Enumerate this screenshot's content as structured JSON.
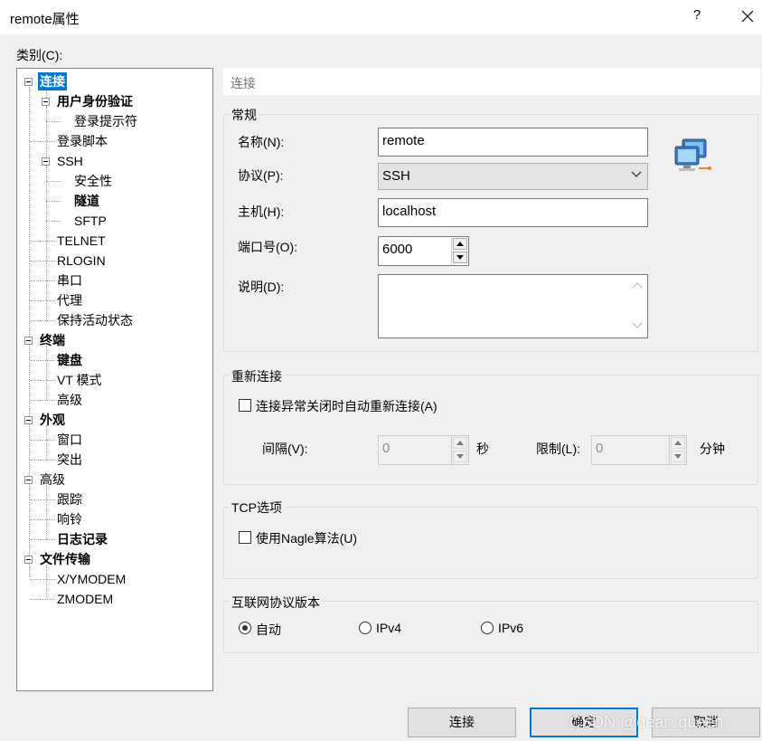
{
  "window": {
    "title": "remote属性",
    "help": "?"
  },
  "category_label": "类别(C):",
  "tree": {
    "items": [
      {
        "label": "连接"
      },
      {
        "label": "用户身份验证"
      },
      {
        "label": "登录提示符"
      },
      {
        "label": "登录脚本"
      },
      {
        "label": "SSH"
      },
      {
        "label": "安全性"
      },
      {
        "label": "隧道"
      },
      {
        "label": "SFTP"
      },
      {
        "label": "TELNET"
      },
      {
        "label": "RLOGIN"
      },
      {
        "label": "串口"
      },
      {
        "label": "代理"
      },
      {
        "label": "保持活动状态"
      },
      {
        "label": "终端"
      },
      {
        "label": "键盘"
      },
      {
        "label": "VT 模式"
      },
      {
        "label": "高级"
      },
      {
        "label": "外观"
      },
      {
        "label": "窗口"
      },
      {
        "label": "突出"
      },
      {
        "label": "高级"
      },
      {
        "label": "跟踪"
      },
      {
        "label": "响铃"
      },
      {
        "label": "日志记录"
      },
      {
        "label": "文件传输"
      },
      {
        "label": "X/YMODEM"
      },
      {
        "label": "ZMODEM"
      }
    ]
  },
  "panel": {
    "header": "连接",
    "general": {
      "title": "常规",
      "name_label": "名称(N):",
      "name_value": "remote",
      "protocol_label": "协议(P):",
      "protocol_value": "SSH",
      "host_label": "主机(H):",
      "host_value": "localhost",
      "port_label": "端口号(O):",
      "port_value": "6000",
      "desc_label": "说明(D):",
      "desc_value": ""
    },
    "reconnect": {
      "title": "重新连接",
      "auto_label": "连接异常关闭时自动重新连接(A)",
      "interval_label": "间隔(V):",
      "interval_value": "0",
      "interval_unit": "秒",
      "limit_label": "限制(L):",
      "limit_value": "0",
      "limit_unit": "分钟"
    },
    "tcp": {
      "title": "TCP选项",
      "nagle_label": "使用Nagle算法(U)"
    },
    "ipver": {
      "title": "互联网协议版本",
      "options": [
        "自动",
        "IPv4",
        "IPv6"
      ],
      "selected": "自动"
    }
  },
  "buttons": {
    "connect": "连接",
    "ok": "确定",
    "cancel": "取消"
  },
  "watermark": "CSDN @dear_queen"
}
